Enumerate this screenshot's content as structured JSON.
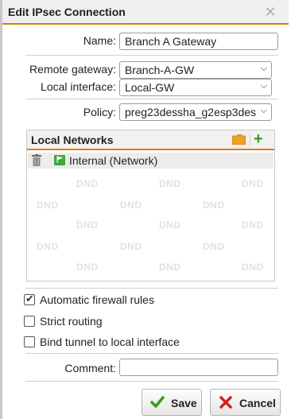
{
  "dialog": {
    "title": "Edit IPsec Connection",
    "close_icon": "close-icon"
  },
  "form": {
    "name_label": "Name:",
    "name_value": "Branch A Gateway",
    "remote_gateway_label": "Remote gateway:",
    "remote_gateway_value": "Branch-A-GW",
    "local_interface_label": "Local interface:",
    "local_interface_value": "Local-GW",
    "policy_label": "Policy:",
    "policy_value": "preg23dessha_g2esp3des",
    "comment_label": "Comment:",
    "comment_value": ""
  },
  "local_networks": {
    "title": "Local Networks",
    "folder_icon": "folder-icon",
    "add_icon": "plus-icon",
    "items": [
      {
        "label": "Internal (Network)",
        "icon": "network-flag-icon",
        "delete_icon": "trash-icon"
      }
    ],
    "placeholder_text": "DND"
  },
  "options": {
    "auto_firewall_label": "Automatic firewall rules",
    "auto_firewall_checked": true,
    "strict_routing_label": "Strict routing",
    "strict_routing_checked": false,
    "bind_tunnel_label": "Bind tunnel to local interface",
    "bind_tunnel_checked": false
  },
  "buttons": {
    "save_label": "Save",
    "cancel_label": "Cancel"
  },
  "colors": {
    "accent": "#e07b00",
    "save_icon": "#3a9a1a",
    "cancel_icon": "#d42020"
  }
}
